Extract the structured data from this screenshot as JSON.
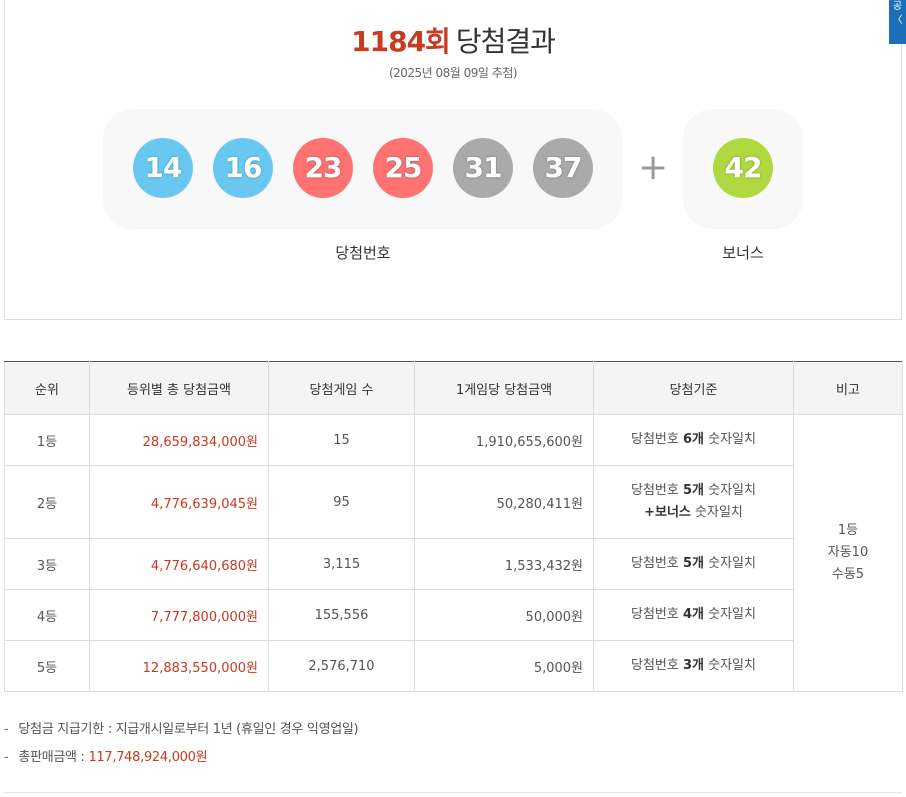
{
  "result": {
    "round": "1184회",
    "title_label": "당첨결과",
    "draw_date": "(2025년 08월 09일 추첨)",
    "winning_numbers": [
      {
        "value": "14",
        "color": "#69c8f2"
      },
      {
        "value": "16",
        "color": "#69c8f2"
      },
      {
        "value": "23",
        "color": "#ff7272"
      },
      {
        "value": "25",
        "color": "#ff7272"
      },
      {
        "value": "31",
        "color": "#aaaaaa"
      },
      {
        "value": "37",
        "color": "#aaaaaa"
      }
    ],
    "plus_symbol": "+",
    "bonus_number": {
      "value": "42",
      "color": "#b0d840"
    },
    "winning_label": "당첨번호",
    "bonus_label": "보너스"
  },
  "side_tab": {
    "chars": [
      "공",
      "〈"
    ]
  },
  "table": {
    "headers": [
      "순위",
      "등위별 총 당첨금액",
      "당첨게임 수",
      "1게임당 당첨금액",
      "당첨기준",
      "비고"
    ],
    "rows": [
      {
        "rank": "1등",
        "total": "28,659,834,000원",
        "games": "15",
        "per_game": "1,910,655,600원",
        "crit_pre": "당첨번호 ",
        "crit_bold": "6개",
        "crit_post": " 숫자일치",
        "crit_line2_bold": "",
        "crit_line2_post": ""
      },
      {
        "rank": "2등",
        "total": "4,776,639,045원",
        "games": "95",
        "per_game": "50,280,411원",
        "crit_pre": "당첨번호 ",
        "crit_bold": "5개",
        "crit_post": " 숫자일치",
        "crit_line2_bold": "+보너스",
        "crit_line2_post": " 숫자일치"
      },
      {
        "rank": "3등",
        "total": "4,776,640,680원",
        "games": "3,115",
        "per_game": "1,533,432원",
        "crit_pre": "당첨번호 ",
        "crit_bold": "5개",
        "crit_post": " 숫자일치",
        "crit_line2_bold": "",
        "crit_line2_post": ""
      },
      {
        "rank": "4등",
        "total": "7,777,800,000원",
        "games": "155,556",
        "per_game": "50,000원",
        "crit_pre": "당첨번호 ",
        "crit_bold": "4개",
        "crit_post": " 숫자일치",
        "crit_line2_bold": "",
        "crit_line2_post": ""
      },
      {
        "rank": "5등",
        "total": "12,883,550,000원",
        "games": "2,576,710",
        "per_game": "5,000원",
        "crit_pre": "당첨번호 ",
        "crit_bold": "3개",
        "crit_post": " 숫자일치",
        "crit_line2_bold": "",
        "crit_line2_post": ""
      }
    ],
    "note": {
      "line1": "1등",
      "line2": "자동10",
      "line3": "수동5"
    }
  },
  "info": {
    "bullet": "-",
    "deadline_label": "당첨금 지급기한 : ",
    "deadline_value": "지급개시일로부터 1년 (휴일인 경우 익영업일)",
    "sales_label": "총판매금액 : ",
    "sales_value": "117,748,924,000원"
  }
}
